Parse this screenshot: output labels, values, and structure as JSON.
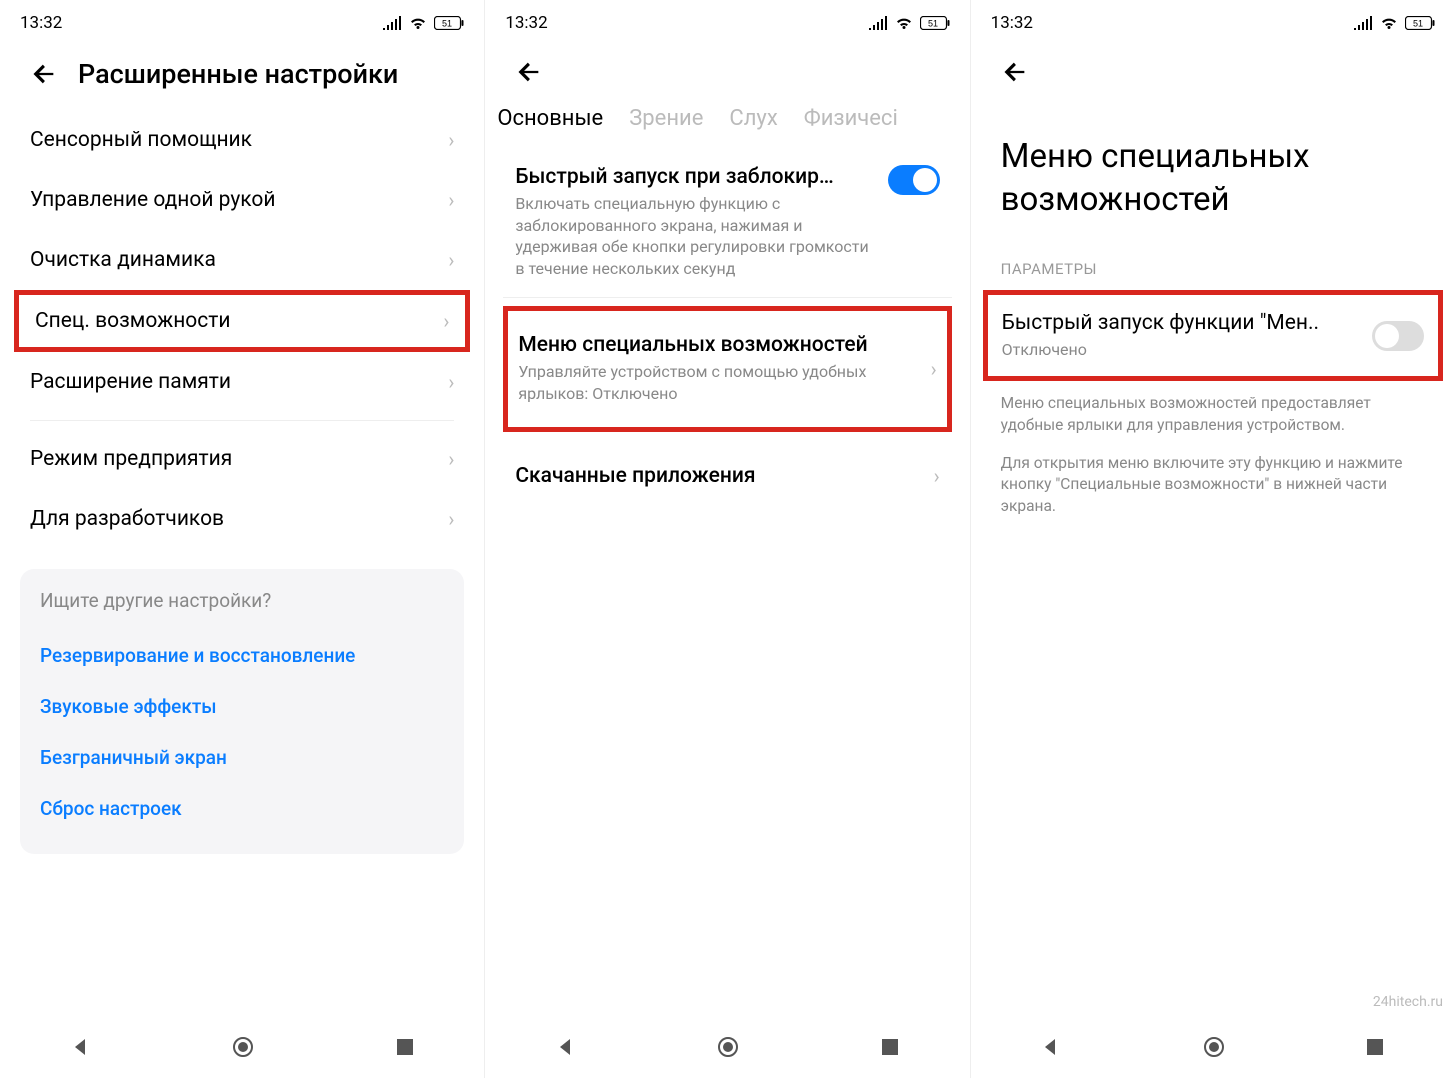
{
  "status": {
    "time": "13:32",
    "battery": "51"
  },
  "screen1": {
    "title": "Расширенные настройки",
    "items": [
      {
        "label": "Сенсорный помощник"
      },
      {
        "label": "Управление одной рукой"
      },
      {
        "label": "Очистка динамика"
      },
      {
        "label": "Спец. возможности",
        "highlight": true
      },
      {
        "label": "Расширение памяти"
      },
      {
        "label": "Режим предприятия",
        "group2": true
      },
      {
        "label": "Для разработчиков"
      }
    ],
    "search": {
      "title": "Ищите другие настройки?",
      "links": [
        "Резервирование и восстановление",
        "Звуковые эффекты",
        "Безграничный экран",
        "Сброс настроек"
      ]
    }
  },
  "screen2": {
    "tabs": [
      "Основные",
      "Зрение",
      "Слух",
      "Физичесі"
    ],
    "active_tab": 0,
    "quick_launch": {
      "title": "Быстрый запуск при заблокир…",
      "desc": "Включать специальную функцию с заблокированного экрана, нажимая и удерживая обе кнопки регулировки громкости в течение нескольких секунд",
      "on": true
    },
    "menu_item": {
      "title": "Меню специальных возможностей",
      "desc": "Управляйте устройством с помощью удобных ярлыков: Отключено"
    },
    "downloads": {
      "label": "Скачанные приложения"
    }
  },
  "screen3": {
    "title": "Меню специальных возможностей",
    "section": "ПАРАМЕТРЫ",
    "toggle_item": {
      "title": "Быстрый запуск функции \"Мен..",
      "sub": "Отключено",
      "on": false
    },
    "desc1": "Меню специальных возможностей предоставляет удобные ярлыки для управления устройством.",
    "desc2": "Для открытия меню включите эту функцию и нажмите кнопку \"Специальные возможности\" в нижней части экрана."
  },
  "watermark": "24hitech.ru"
}
